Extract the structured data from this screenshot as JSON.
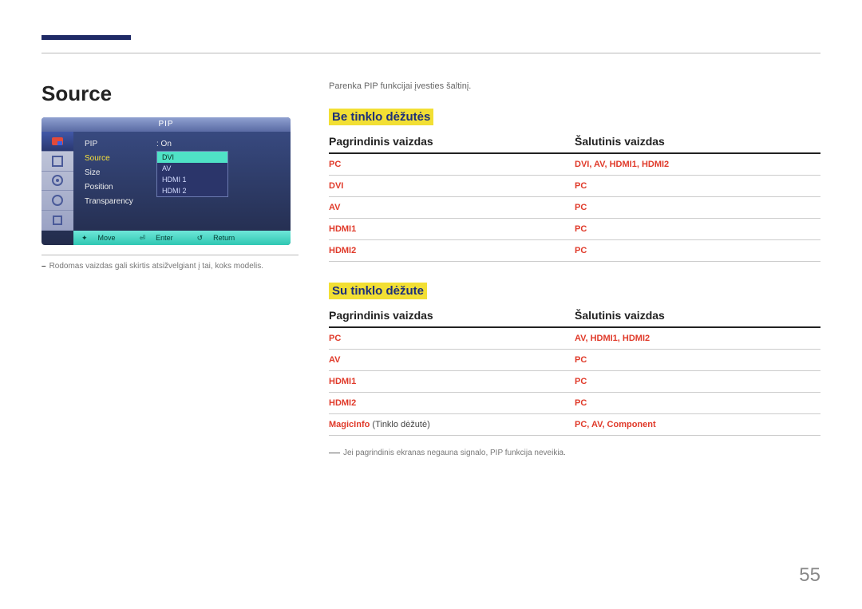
{
  "page": {
    "number": "55"
  },
  "left": {
    "heading": "Source",
    "note": "Rodomas vaizdas gali skirtis atsižvelgiant į tai, koks modelis.",
    "osd": {
      "title": "PIP",
      "rows": [
        {
          "label": "PIP",
          "value": ": On"
        },
        {
          "label": "Source",
          "value": ""
        },
        {
          "label": "Size",
          "value": ""
        },
        {
          "label": "Position",
          "value": ""
        },
        {
          "label": "Transparency",
          "value": ""
        }
      ],
      "dropdown": [
        "DVI",
        "AV",
        "HDMI 1",
        "HDMI 2"
      ],
      "bottom": {
        "move": "Move",
        "enter": "Enter",
        "return": "Return"
      }
    }
  },
  "right": {
    "intro": "Parenka PIP funkcijai įvesties šaltinį.",
    "section1": {
      "title": "Be tinklo dėžutės",
      "col1": "Pagrindinis vaizdas",
      "col2": "Šalutinis vaizdas",
      "rows": [
        {
          "a": "PC",
          "b": "DVI, AV, HDMI1, HDMI2"
        },
        {
          "a": "DVI",
          "b": "PC"
        },
        {
          "a": "AV",
          "b": "PC"
        },
        {
          "a": "HDMI1",
          "b": "PC"
        },
        {
          "a": "HDMI2",
          "b": "PC"
        }
      ]
    },
    "section2": {
      "title": "Su tinklo dėžute",
      "col1": "Pagrindinis vaizdas",
      "col2": "Šalutinis vaizdas",
      "rows": [
        {
          "a": "PC",
          "b": "AV, HDMI1, HDMI2"
        },
        {
          "a": "AV",
          "b": "PC"
        },
        {
          "a": "HDMI1",
          "b": "PC"
        },
        {
          "a": "HDMI2",
          "b": "PC"
        },
        {
          "a": "MagicInfo",
          "a_extra": " (Tinklo dėžutė)",
          "b": "PC, AV, Component"
        }
      ]
    },
    "footnote": "Jei pagrindinis ekranas negauna signalo, PIP funkcija neveikia."
  }
}
